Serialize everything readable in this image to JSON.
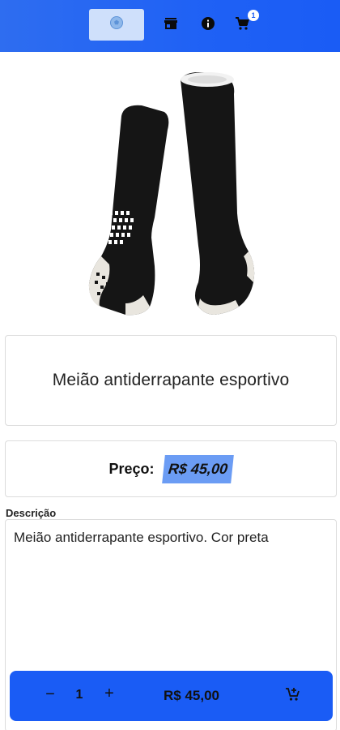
{
  "nav": {
    "items": [
      {
        "name": "home-logo",
        "icon": "soccer-ball-icon"
      },
      {
        "name": "store",
        "icon": "store-icon"
      },
      {
        "name": "info",
        "icon": "info-icon"
      },
      {
        "name": "cart",
        "icon": "cart-icon"
      }
    ],
    "cart_count": "1",
    "colors": {
      "bar": "#1a5cf5",
      "logo_bg": "#cfe0fb"
    }
  },
  "product": {
    "image_alt_icon": "product-socks-image",
    "title": "Meião antiderrapante esportivo",
    "price_label": "Preço:",
    "price": "R$ 45,00",
    "description_label": "Descrição",
    "description": "Meião antiderrapante esportivo. Cor preta"
  },
  "cart_bar": {
    "minus": "−",
    "quantity": "1",
    "plus": "+",
    "total": "R$ 45,00",
    "icon": "add-to-cart-icon"
  }
}
